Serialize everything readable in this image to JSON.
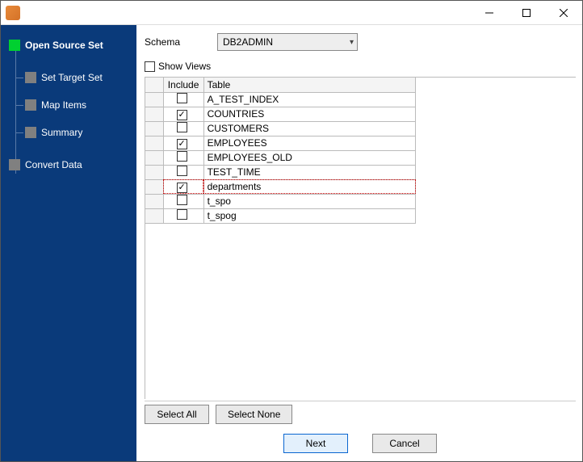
{
  "titlebar": {
    "title": ""
  },
  "sidebar": {
    "items": [
      {
        "label": "Open Source Set",
        "active": true,
        "child": false
      },
      {
        "label": "Set Target Set",
        "active": false,
        "child": true
      },
      {
        "label": "Map Items",
        "active": false,
        "child": true
      },
      {
        "label": "Summary",
        "active": false,
        "child": true
      },
      {
        "label": "Convert Data",
        "active": false,
        "child": false
      }
    ]
  },
  "schema": {
    "label": "Schema",
    "selected": "DB2ADMIN"
  },
  "show_views": {
    "label": "Show Views",
    "checked": false
  },
  "table": {
    "headers": {
      "include": "Include",
      "table": "Table"
    },
    "rows": [
      {
        "include": false,
        "table": "A_TEST_INDEX",
        "selected": false
      },
      {
        "include": true,
        "table": "COUNTRIES",
        "selected": false
      },
      {
        "include": false,
        "table": "CUSTOMERS",
        "selected": false
      },
      {
        "include": true,
        "table": "EMPLOYEES",
        "selected": false
      },
      {
        "include": false,
        "table": "EMPLOYEES_OLD",
        "selected": false
      },
      {
        "include": false,
        "table": "TEST_TIME",
        "selected": false
      },
      {
        "include": true,
        "table": "departments",
        "selected": true
      },
      {
        "include": false,
        "table": "t_spo",
        "selected": false
      },
      {
        "include": false,
        "table": "t_spog",
        "selected": false
      }
    ]
  },
  "buttons": {
    "select_all": "Select All",
    "select_none": "Select None",
    "next": "Next",
    "cancel": "Cancel"
  }
}
